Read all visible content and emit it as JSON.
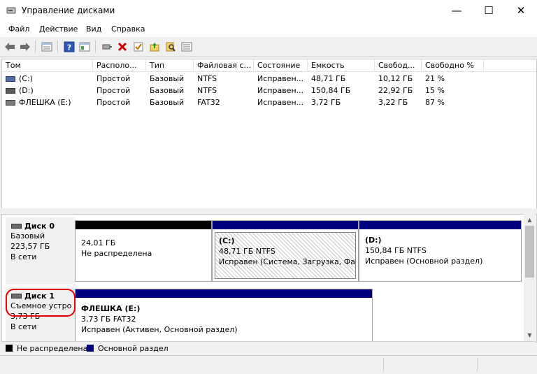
{
  "window": {
    "title": "Управление дисками",
    "minimize_glyph": "—",
    "maximize_glyph": "☐",
    "close_glyph": "✕"
  },
  "menu": [
    "Файл",
    "Действие",
    "Вид",
    "Справка"
  ],
  "columns": [
    "Том",
    "Располо...",
    "Тип",
    "Файловая с...",
    "Состояние",
    "Емкость",
    "Свобод...",
    "Свободно %"
  ],
  "volumes": [
    {
      "name": "(C:)",
      "layout": "Простой",
      "type": "Базовый",
      "fs": "NTFS",
      "status": "Исправен...",
      "capacity": "48,71 ГБ",
      "free": "10,12 ГБ",
      "free_pct": "21 %"
    },
    {
      "name": "(D:)",
      "layout": "Простой",
      "type": "Базовый",
      "fs": "NTFS",
      "status": "Исправен...",
      "capacity": "150,84 ГБ",
      "free": "22,92 ГБ",
      "free_pct": "15 %"
    },
    {
      "name": "ФЛЕШКА (E:)",
      "layout": "Простой",
      "type": "Базовый",
      "fs": "FAT32",
      "status": "Исправен...",
      "capacity": "3,72 ГБ",
      "free": "3,22 ГБ",
      "free_pct": "87 %"
    }
  ],
  "disk0": {
    "name": "Диск 0",
    "type": "Базовый",
    "size": "223,57 ГБ",
    "status": "В сети",
    "unallocated": {
      "size": "24,01 ГБ",
      "label": "Не распределена"
    },
    "c_volume": {
      "title": "(C:)",
      "size": "48,71 ГБ NTFS",
      "status": "Исправен (Система, Загрузка, Файл"
    },
    "d_volume": {
      "title": "(D:)",
      "size": "150,84 ГБ NTFS",
      "status": "Исправен (Основной раздел)"
    }
  },
  "disk1": {
    "name": "Диск 1",
    "type": "Съемное устро",
    "size": "3,73 ГБ",
    "status": "В сети",
    "e_volume": {
      "title": "ФЛЕШКА  (E:)",
      "size": "3,73 ГБ FAT32",
      "status": "Исправен (Активен, Основной раздел)"
    }
  },
  "legend": {
    "unallocated": "Не распределена",
    "primary": "Основной раздел"
  },
  "colors": {
    "primary": "#00007f",
    "unallocated": "#000000",
    "highlight": "#e60000"
  }
}
